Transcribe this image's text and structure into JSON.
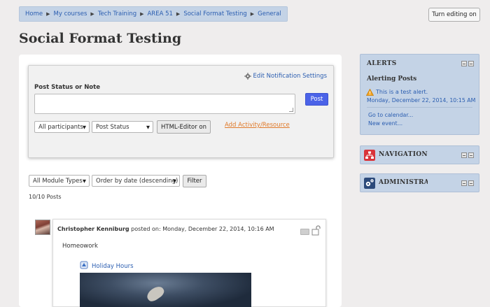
{
  "breadcrumb": [
    "Home",
    "My courses",
    "Tech Training",
    "AREA 51",
    "Social Format Testing",
    "General"
  ],
  "header": {
    "turn_editing": "Turn editing on",
    "title": "Social Format Testing"
  },
  "post_form": {
    "edit_notifications": "Edit Notification Settings",
    "label": "Post Status or Note",
    "textarea_value": "",
    "post_button": "Post",
    "participants_select": "All participants",
    "type_select": "Post Status",
    "html_editor_button": "HTML-Editor on",
    "add_activity": "Add Activity/Resource"
  },
  "filters": {
    "module_types": "All Module Types",
    "order": "Order by date (descending)",
    "filter_button": "Filter",
    "posts_count": "10/10 Posts"
  },
  "post": {
    "author": "Christopher Kenniburg",
    "posted_on": "posted on: Monday, December 22, 2014, 10:16 AM",
    "body": "Homeowork",
    "embed_title": "Holiday Hours"
  },
  "alerts": {
    "title": "ALERTS",
    "subtitle": "Alerting Posts",
    "alert_text": "This is a test alert.",
    "alert_date": "Monday, December 22, 2014, 10:15 AM",
    "go_calendar": "Go to calendar...",
    "new_event": "New event..."
  },
  "navigation": {
    "title": "NAVIGATION",
    "icon_color": "#d9343a"
  },
  "administration": {
    "title": "ADMINISTRATION",
    "icon_color": "#2c4a7a"
  },
  "colors": {
    "accent": "#4b63e8",
    "block_bg": "#c4d3e6",
    "link": "#2a5db0",
    "orange_link": "#e07a2a"
  }
}
